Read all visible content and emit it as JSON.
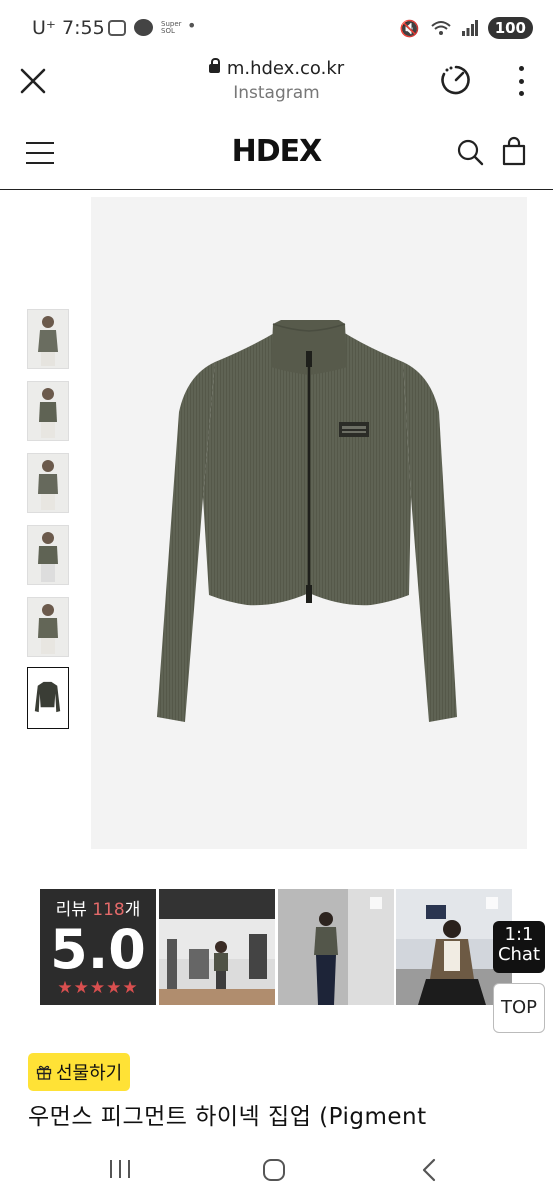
{
  "status_bar": {
    "carrier": "U⁺",
    "time": "7:55",
    "battery": "100"
  },
  "browser": {
    "url": "m.hdex.co.kr",
    "source": "Instagram"
  },
  "site": {
    "logo": "HDEX"
  },
  "product": {
    "thumbnail_count": 6,
    "selected_thumbnail": 6,
    "title": "우먼스 피그먼트 하이넥 집업 (Pigment",
    "gift_label": "선물하기"
  },
  "reviews": {
    "label_prefix": "리뷰",
    "count": "118",
    "label_suffix": "개",
    "score": "5.0",
    "stars": "★★★★★",
    "star_rating": 5
  },
  "floating": {
    "chat_line1": "1:1",
    "chat_line2": "Chat",
    "top": "TOP"
  },
  "colors": {
    "gift_bg": "#ffe236",
    "review_count": "#e36a6a",
    "stars": "#d94f4f",
    "jacket": "#5f6354"
  },
  "icons": [
    "close-icon",
    "lock-icon",
    "speed-icon",
    "more-icon",
    "menu-icon",
    "search-icon",
    "cart-icon",
    "gift-icon",
    "recent-apps-icon",
    "home-icon",
    "back-icon"
  ]
}
